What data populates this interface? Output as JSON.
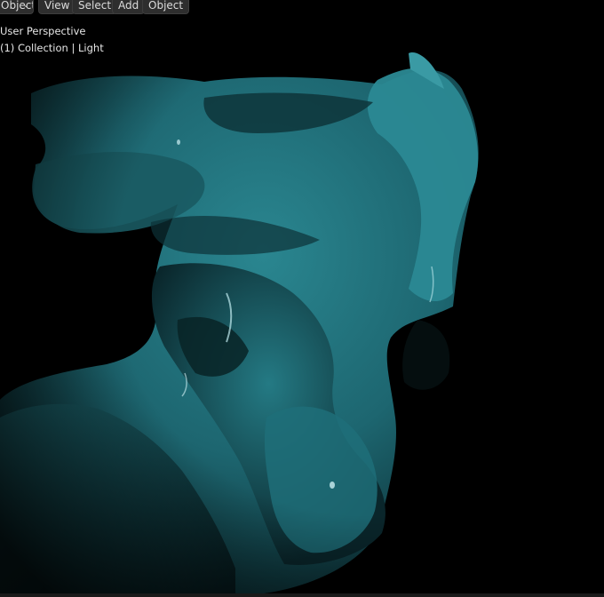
{
  "header": {
    "mode_label": "Object Mode",
    "menu": [
      "View",
      "Select",
      "Add",
      "Object"
    ]
  },
  "viewport": {
    "perspective_label": "User Perspective",
    "collection_label": "(1) Collection | Light"
  },
  "colors": {
    "background": "#000000",
    "sculpture": "#1f6e78",
    "header_button": "#2e2e2e",
    "overlay_text": "#e6e6e6"
  },
  "icons": [
    "chevron-down-icon"
  ]
}
